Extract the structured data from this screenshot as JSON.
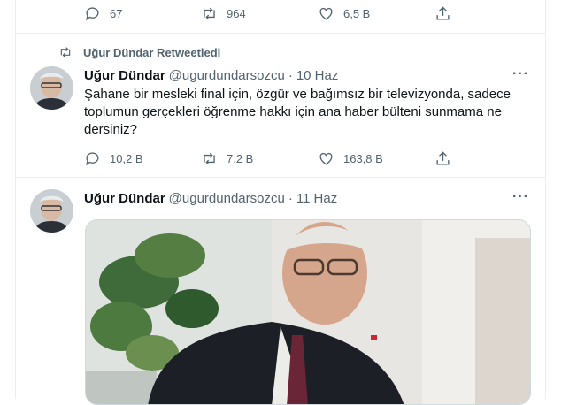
{
  "top_tweet": {
    "reply_count": "67",
    "retweet_count": "964",
    "like_count": "6,5 B"
  },
  "tweet1": {
    "retweet_label": "Uğur Dündar Retweetledi",
    "author": "Uğur Dündar",
    "handle": "@ugurdundarsozcu",
    "separator": "·",
    "date": "10 Haz",
    "more": "···",
    "text": "Şahane bir mesleki final için, özgür ve bağımsız bir televizyonda, sadece toplumun gerçekleri öğrenme hakkı için ana haber bülteni sunmama ne dersiniz?",
    "reply_count": "10,2 B",
    "retweet_count": "7,2 B",
    "like_count": "163,8 B"
  },
  "tweet2": {
    "author": "Uğur Dündar",
    "handle": "@ugurdundarsozcu",
    "separator": "·",
    "date": "11 Haz",
    "more": "···"
  },
  "icons": [
    "reply-icon",
    "retweet-icon",
    "like-icon",
    "share-icon",
    "more-icon"
  ],
  "colors": {
    "muted": "#536471",
    "text": "#0f1419",
    "border": "#ebeef0"
  }
}
